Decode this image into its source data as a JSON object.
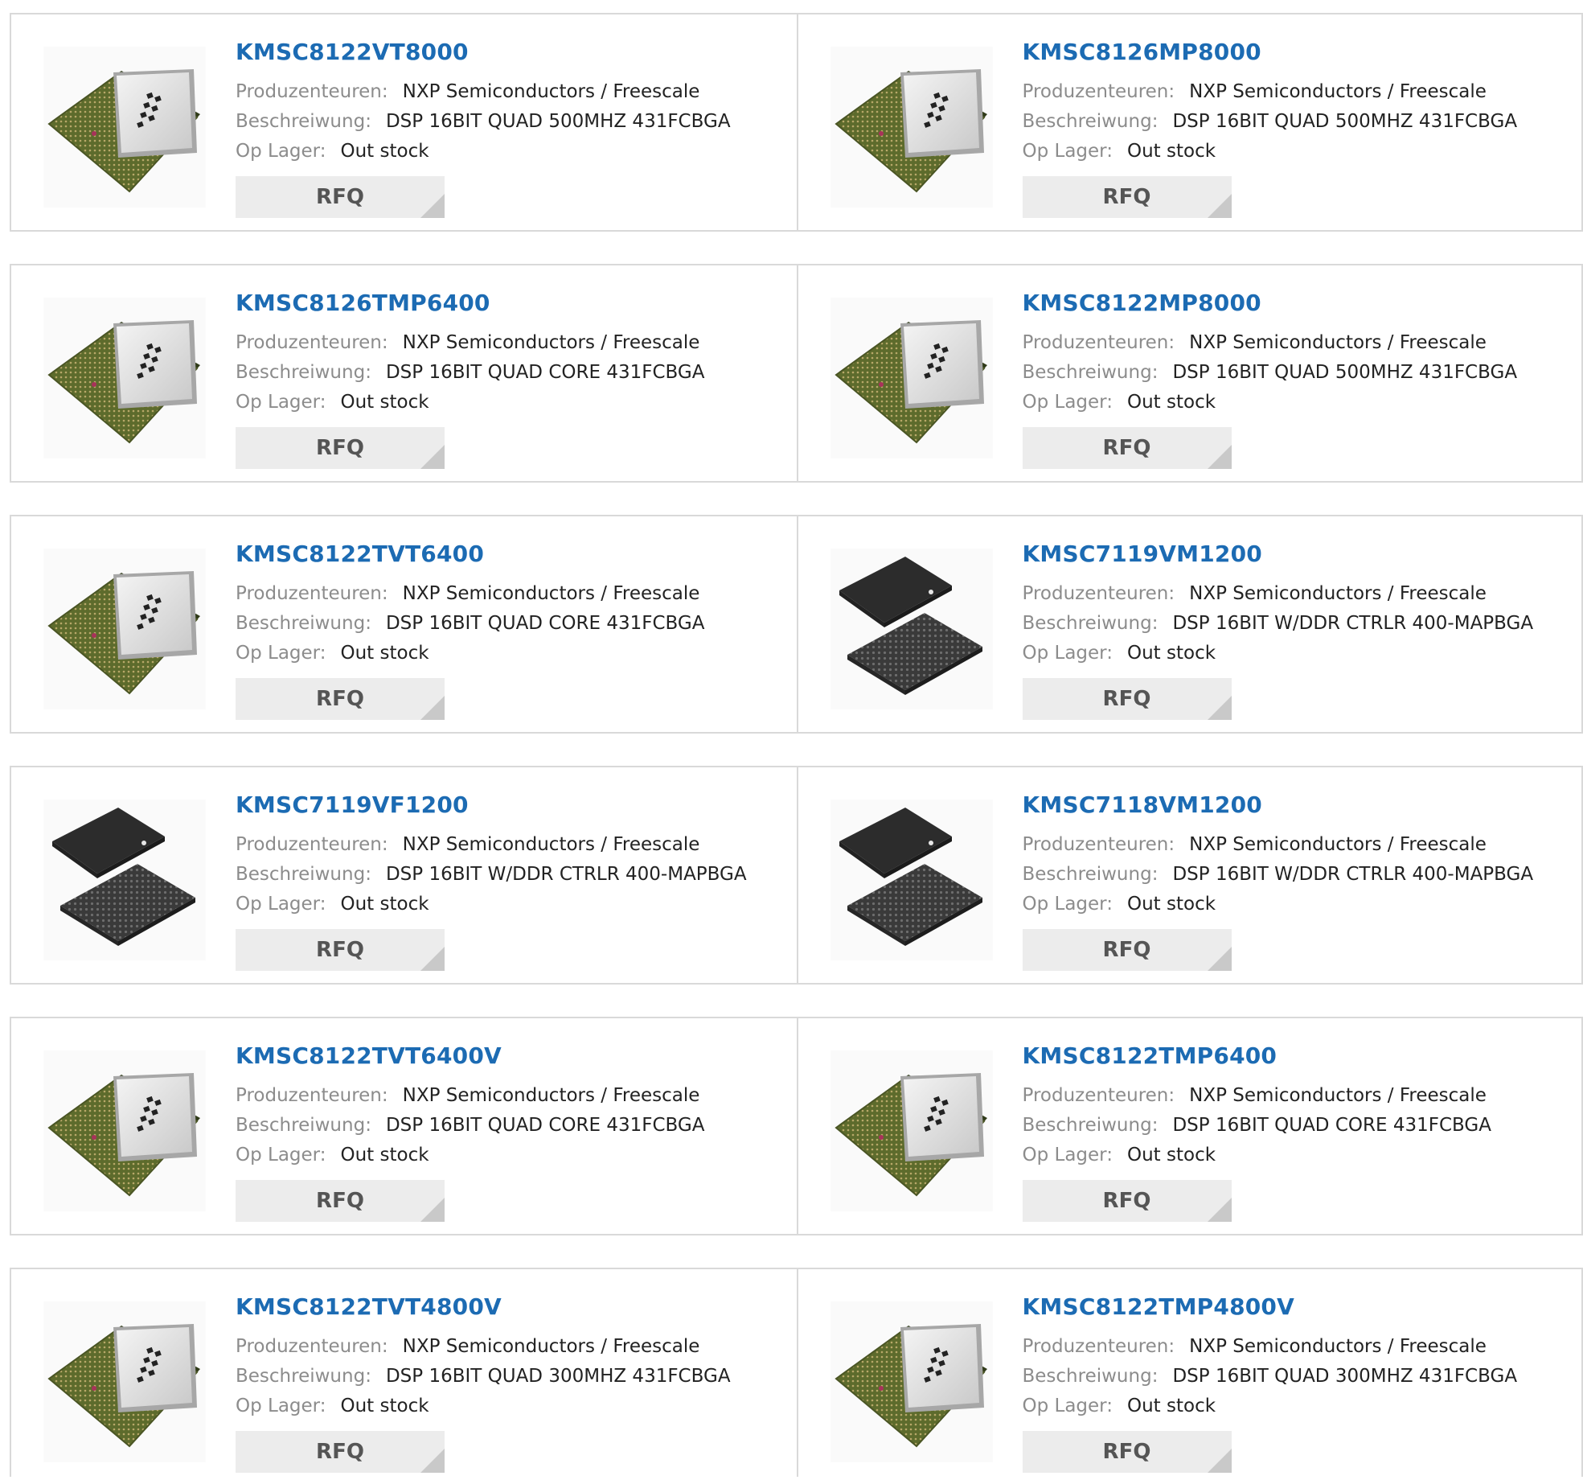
{
  "labels": {
    "manufacturer": "Produzenteuren:",
    "description": "Beschreiwung:",
    "stock": "Op Lager:",
    "rfq": "RFQ"
  },
  "products": [
    {
      "part": "KMSC8122VT8000",
      "manufacturer": "NXP Semiconductors / Freescale",
      "description": "DSP 16BIT QUAD 500MHZ 431FCBGA",
      "stock": "Out stock",
      "image": "fcbga-chip"
    },
    {
      "part": "KMSC8126MP8000",
      "manufacturer": "NXP Semiconductors / Freescale",
      "description": "DSP 16BIT QUAD 500MHZ 431FCBGA",
      "stock": "Out stock",
      "image": "fcbga-chip"
    },
    {
      "part": "KMSC8126TMP6400",
      "manufacturer": "NXP Semiconductors / Freescale",
      "description": "DSP 16BIT QUAD CORE 431FCBGA",
      "stock": "Out stock",
      "image": "fcbga-chip"
    },
    {
      "part": "KMSC8122MP8000",
      "manufacturer": "NXP Semiconductors / Freescale",
      "description": "DSP 16BIT QUAD 500MHZ 431FCBGA",
      "stock": "Out stock",
      "image": "fcbga-chip"
    },
    {
      "part": "KMSC8122TVT6400",
      "manufacturer": "NXP Semiconductors / Freescale",
      "description": "DSP 16BIT QUAD CORE 431FCBGA",
      "stock": "Out stock",
      "image": "fcbga-chip"
    },
    {
      "part": "KMSC7119VM1200",
      "manufacturer": "NXP Semiconductors / Freescale",
      "description": "DSP 16BIT W/DDR CTRLR 400-MAPBGA",
      "stock": "Out stock",
      "image": "mapbga-chip"
    },
    {
      "part": "KMSC7119VF1200",
      "manufacturer": "NXP Semiconductors / Freescale",
      "description": "DSP 16BIT W/DDR CTRLR 400-MAPBGA",
      "stock": "Out stock",
      "image": "mapbga-chip"
    },
    {
      "part": "KMSC7118VM1200",
      "manufacturer": "NXP Semiconductors / Freescale",
      "description": "DSP 16BIT W/DDR CTRLR 400-MAPBGA",
      "stock": "Out stock",
      "image": "mapbga-chip"
    },
    {
      "part": "KMSC8122TVT6400V",
      "manufacturer": "NXP Semiconductors / Freescale",
      "description": "DSP 16BIT QUAD CORE 431FCBGA",
      "stock": "Out stock",
      "image": "fcbga-chip"
    },
    {
      "part": "KMSC8122TMP6400",
      "manufacturer": "NXP Semiconductors / Freescale",
      "description": "DSP 16BIT QUAD CORE 431FCBGA",
      "stock": "Out stock",
      "image": "fcbga-chip"
    },
    {
      "part": "KMSC8122TVT4800V",
      "manufacturer": "NXP Semiconductors / Freescale",
      "description": "DSP 16BIT QUAD 300MHZ 431FCBGA",
      "stock": "Out stock",
      "image": "fcbga-chip"
    },
    {
      "part": "KMSC8122TMP4800V",
      "manufacturer": "NXP Semiconductors / Freescale",
      "description": "DSP 16BIT QUAD 300MHZ 431FCBGA",
      "stock": "Out stock",
      "image": "fcbga-chip"
    }
  ]
}
